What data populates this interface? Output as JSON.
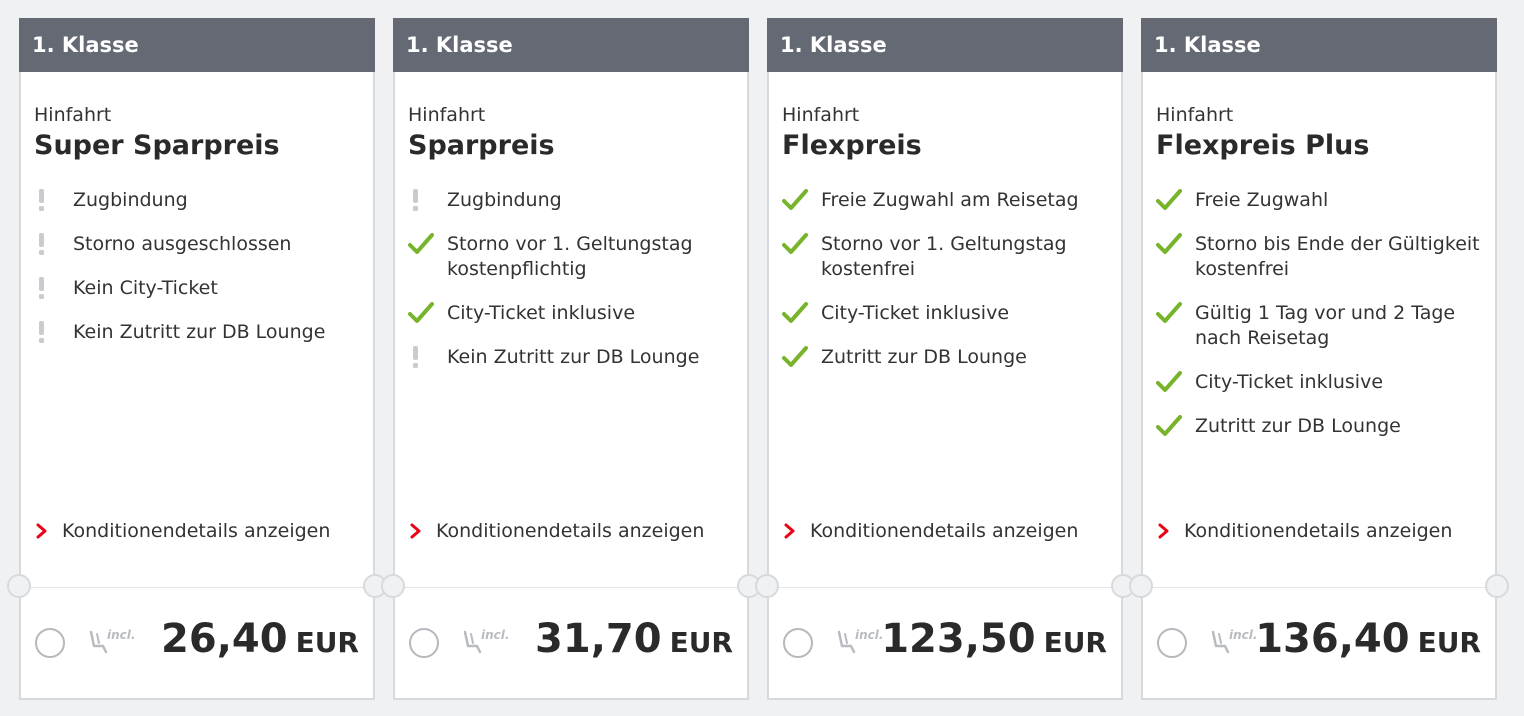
{
  "offers": [
    {
      "class": "1. Klasse",
      "direction": "Hinfahrt",
      "tariff": "Super Sparpreis",
      "features": [
        {
          "text": "Zugbindung",
          "icon": "exclamation-icon"
        },
        {
          "text": "Storno ausgeschlossen",
          "icon": "exclamation-icon"
        },
        {
          "text": "Kein City-Ticket",
          "icon": "exclamation-icon"
        },
        {
          "text": "Kein Zutritt zur DB Lounge",
          "icon": "exclamation-icon"
        }
      ],
      "conditions_link": "Konditionendetails anzeigen",
      "seat_label": "incl.",
      "price": "26,40",
      "currency": "EUR"
    },
    {
      "class": "1. Klasse",
      "direction": "Hinfahrt",
      "tariff": "Sparpreis",
      "features": [
        {
          "text": "Zugbindung",
          "icon": "exclamation-icon"
        },
        {
          "text": "Storno vor 1. Geltungstag kostenpflichtig",
          "icon": "check-icon"
        },
        {
          "text": "City-Ticket inklusive",
          "icon": "check-icon"
        },
        {
          "text": "Kein Zutritt zur DB Lounge",
          "icon": "exclamation-icon"
        }
      ],
      "conditions_link": "Konditionendetails anzeigen",
      "seat_label": "incl.",
      "price": "31,70",
      "currency": "EUR"
    },
    {
      "class": "1. Klasse",
      "direction": "Hinfahrt",
      "tariff": "Flexpreis",
      "features": [
        {
          "text": "Freie Zugwahl am Reisetag",
          "icon": "check-icon"
        },
        {
          "text": "Storno vor 1. Geltungstag kostenfrei",
          "icon": "check-icon"
        },
        {
          "text": "City-Ticket inklusive",
          "icon": "check-icon"
        },
        {
          "text": "Zutritt zur DB Lounge",
          "icon": "check-icon"
        }
      ],
      "conditions_link": "Konditionendetails anzeigen",
      "seat_label": "incl.",
      "price": "123,50",
      "currency": "EUR"
    },
    {
      "class": "1. Klasse",
      "direction": "Hinfahrt",
      "tariff": "Flexpreis Plus",
      "features": [
        {
          "text": "Freie Zugwahl",
          "icon": "check-icon"
        },
        {
          "text": "Storno bis Ende der Gültigkeit kostenfrei",
          "icon": "check-icon"
        },
        {
          "text": "Gültig 1 Tag vor und 2 Tage nach Reisetag",
          "icon": "check-icon"
        },
        {
          "text": "City-Ticket inklusive",
          "icon": "check-icon"
        },
        {
          "text": "Zutritt zur DB Lounge",
          "icon": "check-icon"
        }
      ],
      "conditions_link": "Konditionendetails anzeigen",
      "seat_label": "incl.",
      "price": "136,40",
      "currency": "EUR"
    }
  ],
  "colors": {
    "header_bg": "#646973",
    "check": "#78b42b",
    "exclamation": "#c8ccd0",
    "chevron": "#ec0016",
    "text": "#2a2a2a"
  }
}
